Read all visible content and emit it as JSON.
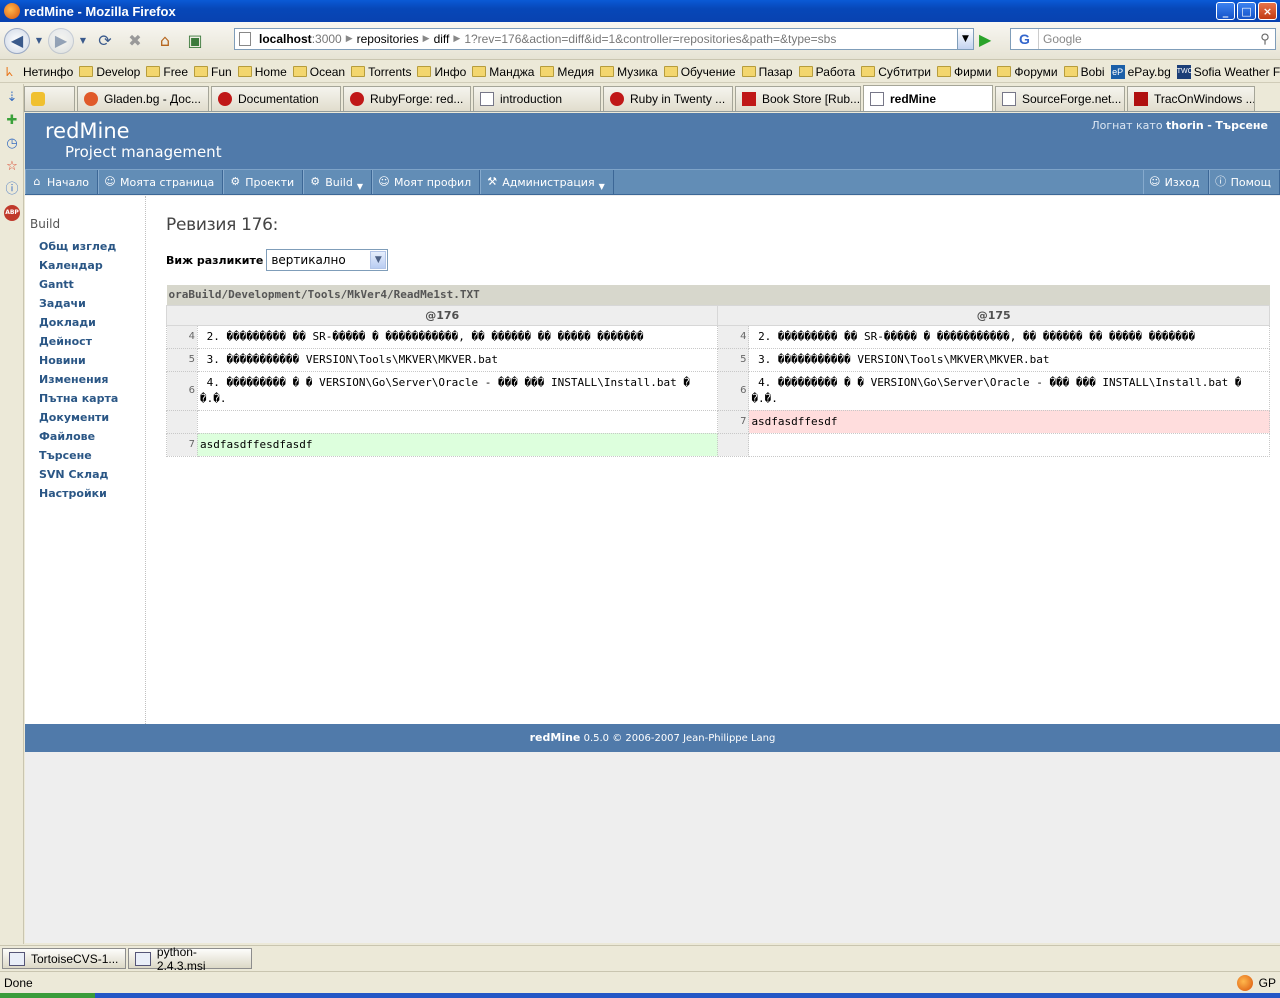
{
  "window": {
    "title": "redMine - Mozilla Firefox"
  },
  "urlbar": {
    "host": "localhost",
    "port": ":3000",
    "segments": [
      "repositories",
      "diff",
      "1"
    ],
    "query": "?rev=176&action=diff&id=1&controller=repositories&path=&type=sbs"
  },
  "search": {
    "engine": "G",
    "placeholder": "Google"
  },
  "bookmarks": [
    "Нетинфо",
    "Develop",
    "Free",
    "Fun",
    "Home",
    "Ocean",
    "Torrents",
    "Инфо",
    "Манджа",
    "Медия",
    "Музика",
    "Обучение",
    "Пазар",
    "Работа",
    "Субтитри",
    "Фирми",
    "Форуми",
    "Bobi",
    "ePay.bg",
    "Sofia Weather Foreca..."
  ],
  "tabs": [
    {
      "label": ""
    },
    {
      "label": "Gladen.bg - Дос..."
    },
    {
      "label": "Documentation"
    },
    {
      "label": "RubyForge: red..."
    },
    {
      "label": "introduction"
    },
    {
      "label": "Ruby in Twenty ..."
    },
    {
      "label": "Book Store [Rub..."
    },
    {
      "label": "redMine"
    },
    {
      "label": "SourceForge.net..."
    },
    {
      "label": "TracOnWindows ..."
    }
  ],
  "header": {
    "brand": "redMine",
    "subtitle": "Project management",
    "login_prefix": "Логнат като",
    "user": "thorin",
    "separator": "-",
    "search_link": "Търсене"
  },
  "menu": {
    "home": "Начало",
    "my_page": "Моята страница",
    "projects": "Проекти",
    "build": "Build",
    "my_account": "Моят профил",
    "admin": "Администрация",
    "logout": "Изход",
    "help": "Помощ"
  },
  "sidebar": {
    "project": "Build",
    "items": [
      "Общ изглед",
      "Календар",
      "Gantt",
      "Задачи",
      "Доклади",
      "Дейност",
      "Новини",
      "Изменения",
      "Пътна карта",
      "Документи",
      "Файлове",
      "Търсене",
      "SVN Склад",
      "Настройки"
    ]
  },
  "content": {
    "title": "Ревизия 176:",
    "view_label": "Виж разликите",
    "view_value": "вертикално",
    "file_path": "oraBuild/Development/Tools/MkVer4/ReadMe1st.TXT",
    "rev_new": "@176",
    "rev_old": "@175",
    "rows": [
      {
        "ln_left": "4",
        "left": " 2. ��������� �� SR-����� � �����������, �� ������ �� ����� �������",
        "ln_right": "4",
        "right": " 2. ��������� �� SR-����� � �����������, �� ������ �� ����� �������"
      },
      {
        "ln_left": "5",
        "left": " 3. ����������� VERSION\\Tools\\MKVER\\MKVER.bat",
        "ln_right": "5",
        "right": " 3. ����������� VERSION\\Tools\\MKVER\\MKVER.bat"
      },
      {
        "ln_left": "6",
        "left": " 4. ��������� � � VERSION\\Go\\Server\\Oracle - ��� ��� INSTALL\\Install.bat � �.�.",
        "ln_right": "6",
        "right": " 4. ��������� � � VERSION\\Go\\Server\\Oracle - ��� ��� INSTALL\\Install.bat � �.�."
      },
      {
        "ln_left": "",
        "left": "",
        "ln_right": "7",
        "right": "asdfasdffesdf"
      },
      {
        "ln_left": "7",
        "left": "asdfasdffesdfasdf",
        "ln_right": "",
        "right": ""
      }
    ]
  },
  "footer": {
    "brand": "redMine",
    "text": "0.5.0 © 2006-2007 Jean-Philippe Lang"
  },
  "taskbar": [
    "TortoiseCVS-1...",
    "python-2.4.3.msi"
  ],
  "status": {
    "text": "Done",
    "right": "GP"
  }
}
